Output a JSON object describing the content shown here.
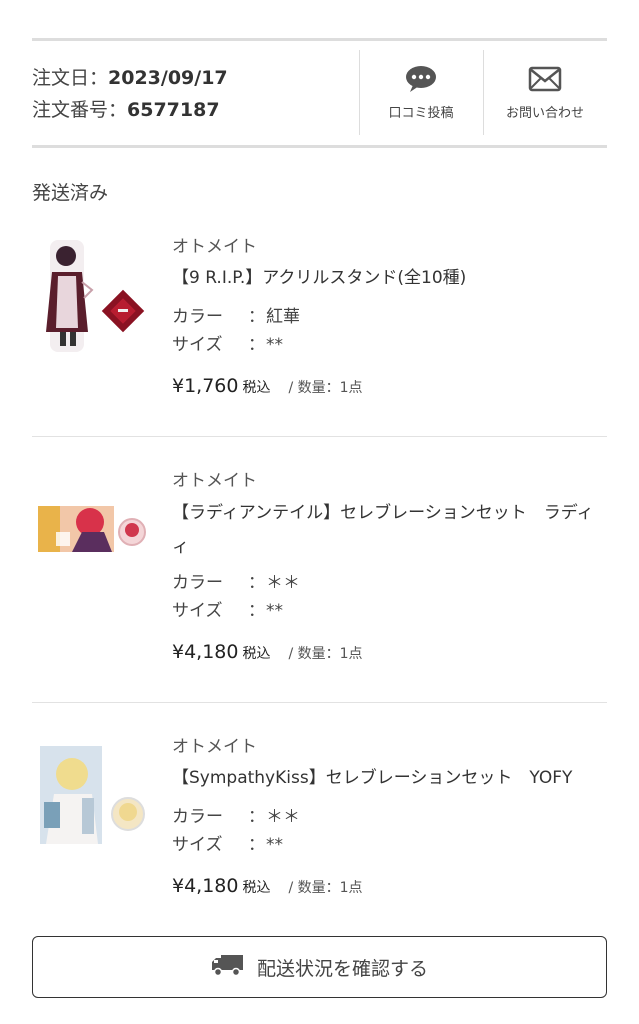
{
  "order": {
    "date_label": "注文日：",
    "date_value": "2023/09/17",
    "number_label": "注文番号：",
    "number_value": "6577187"
  },
  "actions": {
    "review_label": "口コミ投稿",
    "contact_label": "お問い合わせ"
  },
  "section_title": "発送済み",
  "items": [
    {
      "shop": "オトメイト",
      "name": "【9 R.I.P.】アクリルスタンド(全10種)",
      "color_key": "カラー",
      "color_val": "紅華",
      "size_key": "サイズ",
      "size_val": "**",
      "colon": "：",
      "price": "¥1,760",
      "tax": "税込",
      "qty": "/ 数量：1点"
    },
    {
      "shop": "オトメイト",
      "name": "【ラディアンテイル】セレブレーションセット　ラディ",
      "color_key": "カラー",
      "color_val": "＊＊",
      "size_key": "サイズ",
      "size_val": "**",
      "colon": "：",
      "price": "¥4,180",
      "tax": "税込",
      "qty": "/ 数量：1点"
    },
    {
      "shop": "オトメイト",
      "name": "【SympathyKiss】セレブレーションセット　YOFY",
      "color_key": "カラー",
      "color_val": "＊＊",
      "size_key": "サイズ",
      "size_val": "**",
      "colon": "：",
      "price": "¥4,180",
      "tax": "税込",
      "qty": "/ 数量：1点"
    }
  ],
  "shipping_button": "配送状況を確認する",
  "icons": {
    "review": "speech-bubble-icon",
    "contact": "envelope-icon",
    "truck": "truck-icon"
  },
  "colors": {
    "divider": "#dddddd",
    "text": "#333333",
    "icon": "#555555"
  }
}
